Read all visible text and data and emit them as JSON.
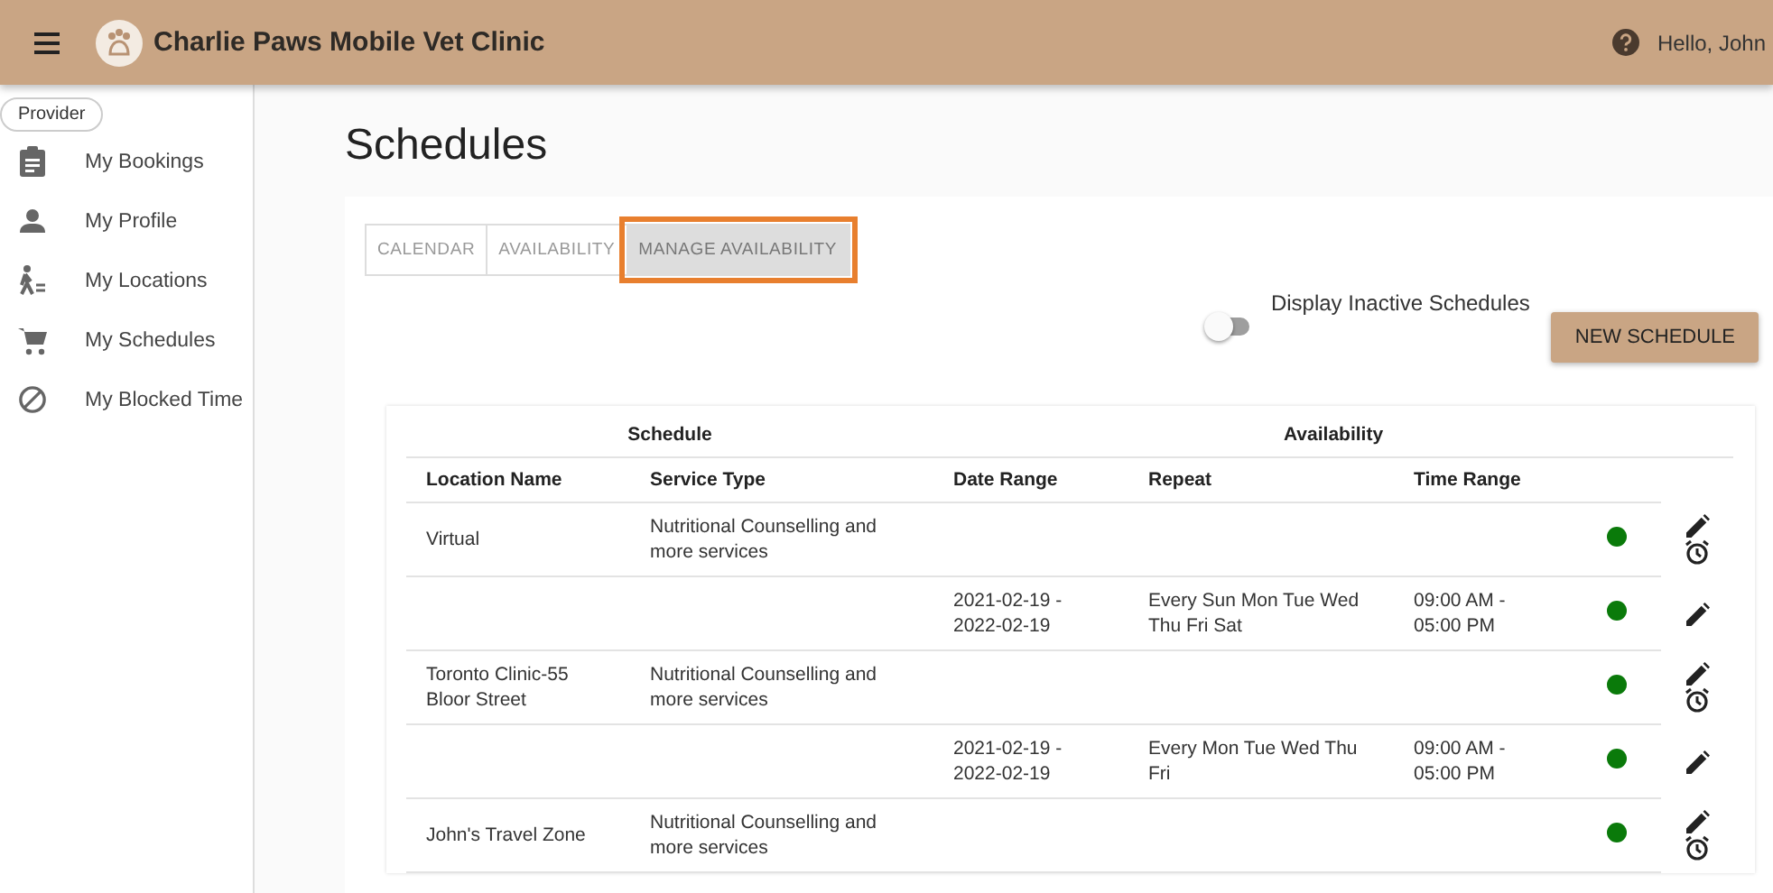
{
  "header": {
    "title": "Charlie Paws Mobile Vet Clinic",
    "greeting": "Hello, John"
  },
  "sidebar": {
    "role": "Provider",
    "items": [
      {
        "label": "My Bookings",
        "selected": false
      },
      {
        "label": "My Profile",
        "selected": false
      },
      {
        "label": "My Locations",
        "selected": false
      },
      {
        "label": "My Schedules",
        "selected": false
      },
      {
        "label": "My Blocked Time",
        "selected": false
      }
    ]
  },
  "page_title": "Schedules",
  "tabs": [
    {
      "label": "CALENDAR",
      "selected": false,
      "highlighted": false
    },
    {
      "label": "AVAILABILITY",
      "selected": false,
      "highlighted": false
    },
    {
      "label": "MANAGE AVAILABILITY",
      "selected": true,
      "highlighted": true
    }
  ],
  "inactive_toggle": {
    "label": "Display Inactive Schedules",
    "on": false
  },
  "new_button": "NEW SCHEDULE",
  "table": {
    "groups": [
      "Schedule",
      "Availability"
    ],
    "columns": [
      "Location Name",
      "Service Type",
      "Date Range",
      "Repeat",
      "Time Range"
    ],
    "rows": [
      {
        "kind": "schedule",
        "cells": [
          "Virtual",
          "Nutritional Counselling and more services",
          "",
          "",
          ""
        ],
        "active": true
      },
      {
        "kind": "availability",
        "cells": [
          "",
          "",
          "2021-02-19 - 2022-02-19",
          "Every Sun Mon Tue Wed Thu Fri Sat",
          "09:00 AM - 05:00 PM"
        ],
        "active": true
      },
      {
        "kind": "schedule",
        "cells": [
          "Toronto Clinic-55 Bloor Street",
          "Nutritional Counselling and more services",
          "",
          "",
          ""
        ],
        "active": true
      },
      {
        "kind": "availability",
        "cells": [
          "",
          "",
          "2021-02-19 - 2022-02-19",
          "Every Mon Tue Wed Thu Fri",
          "09:00 AM - 05:00 PM"
        ],
        "active": true
      },
      {
        "kind": "schedule",
        "cells": [
          "John's Travel Zone",
          "Nutritional Counselling and more services",
          "",
          "",
          ""
        ],
        "active": true
      }
    ]
  }
}
